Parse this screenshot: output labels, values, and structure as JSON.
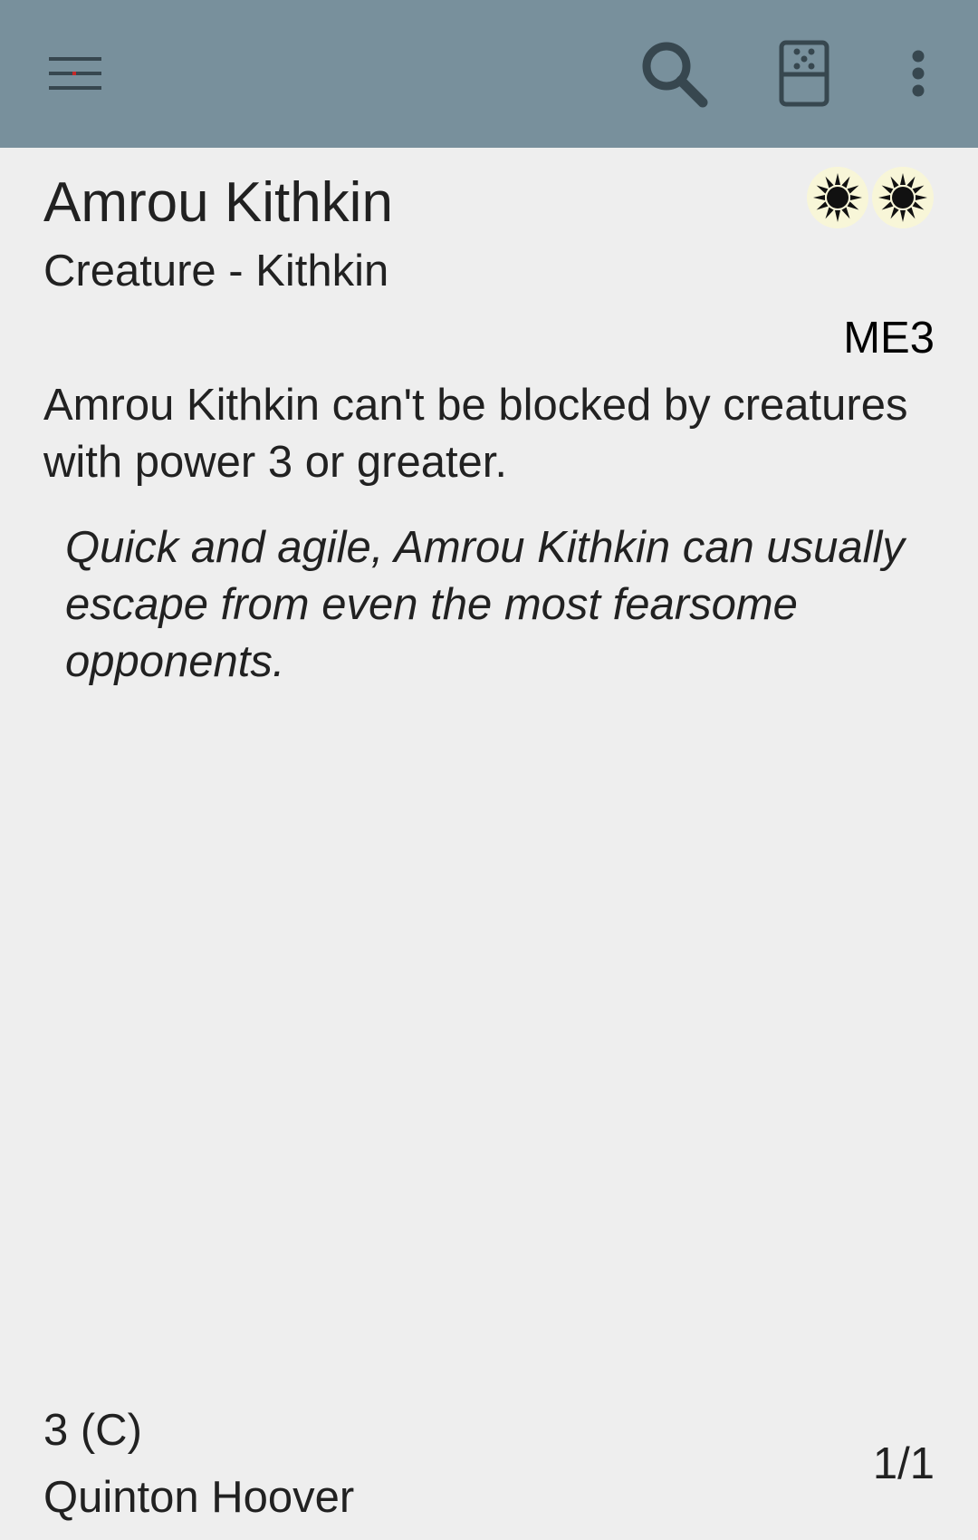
{
  "toolbar": {
    "background": "#78909c",
    "menu_icon": "hamburger-menu-icon",
    "search_icon": "search-icon",
    "dice_icon": "dice-icon",
    "overflow_icon": "more-vert-icon"
  },
  "card": {
    "name": "Amrou Kithkin",
    "mana_cost": [
      "W",
      "W"
    ],
    "type_line": "Creature - Kithkin",
    "set_code": "ME3",
    "rules_text": "Amrou Kithkin can't be blocked by creatures with power 3 or greater.",
    "flavor_text": "Quick and agile, Amrou Kithkin can usually escape from even the most fearsome opponents.",
    "cmc_rarity": "3 (C)",
    "artist": "Quinton Hoover",
    "power_toughness": "1/1"
  }
}
